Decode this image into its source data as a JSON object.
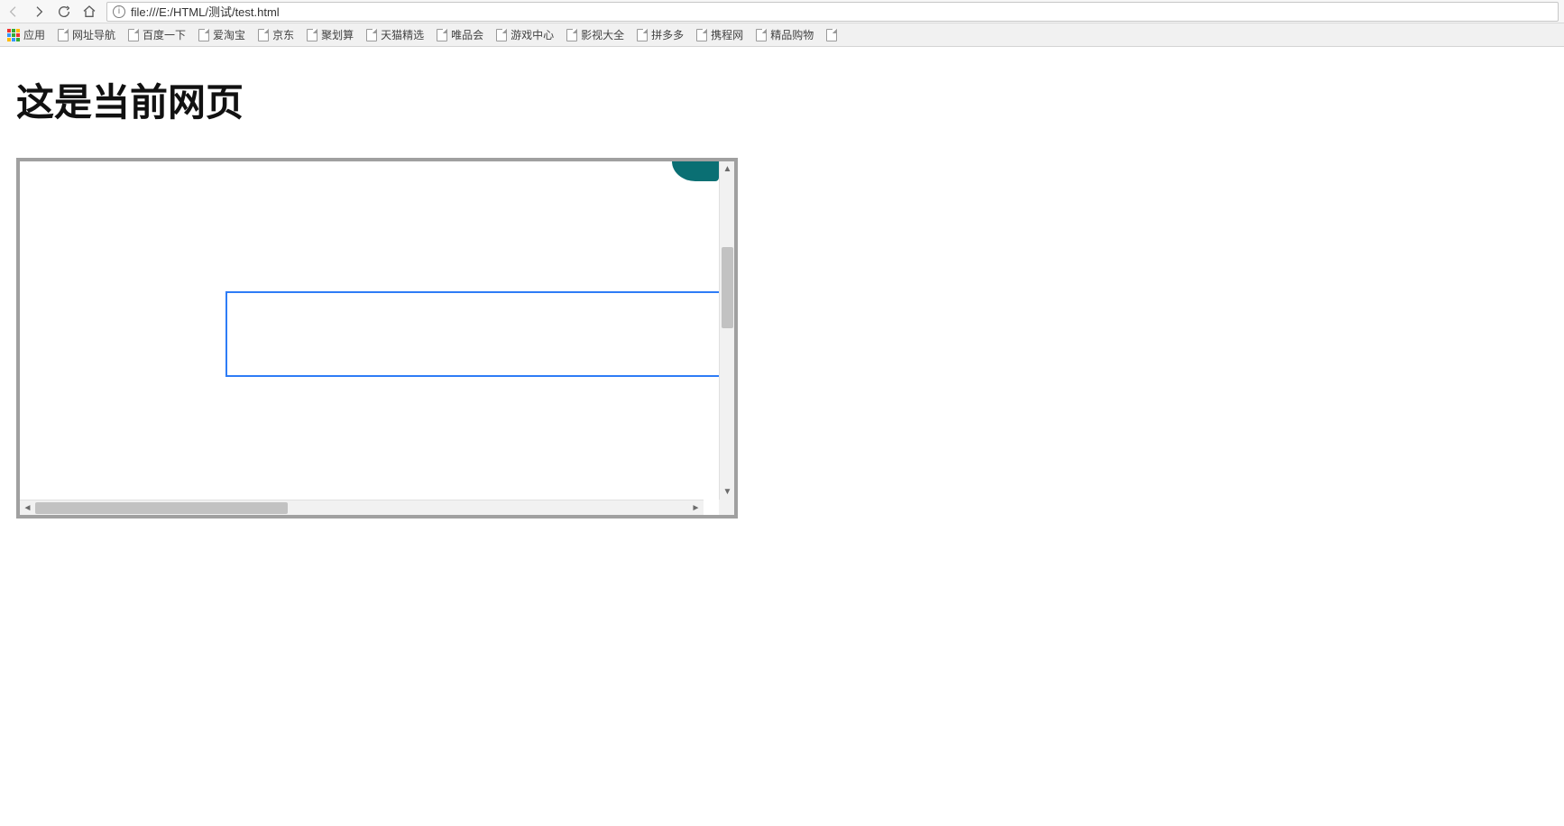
{
  "browser": {
    "url": "file:///E:/HTML/测试/test.html"
  },
  "bookmarks": {
    "apps_label": "应用",
    "items": [
      "网址导航",
      "百度一下",
      "爱淘宝",
      "京东",
      "聚划算",
      "天猫精选",
      "唯品会",
      "游戏中心",
      "影视大全",
      "拼多多",
      "携程网",
      "精品购物",
      ""
    ]
  },
  "page": {
    "title": "这是当前网页"
  }
}
